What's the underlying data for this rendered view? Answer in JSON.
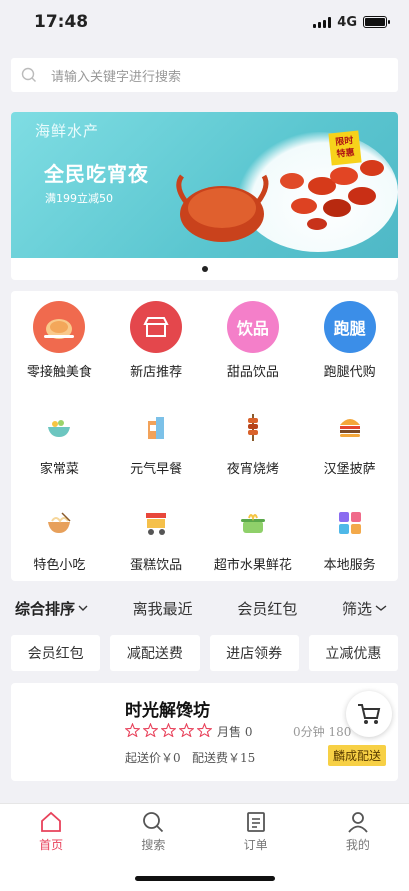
{
  "status": {
    "time": "17:48",
    "network": "4G"
  },
  "search": {
    "placeholder": "请输入关键字进行搜索"
  },
  "banner": {
    "category": "海鲜水产",
    "title": "全民吃宵夜",
    "subtitle": "满199立减50",
    "seal_line1": "限时",
    "seal_line2": "特惠"
  },
  "categories": [
    {
      "label": "零接触美食",
      "icon": "roast-chicken-icon"
    },
    {
      "label": "新店推荐",
      "icon": "shop-icon"
    },
    {
      "label": "甜品饮品",
      "icon": "drink-icon",
      "icon_text": "饮品"
    },
    {
      "label": "跑腿代购",
      "icon": "errand-icon",
      "icon_text": "跑腿"
    },
    {
      "label": "家常菜",
      "icon": "bowl-icon"
    },
    {
      "label": "元气早餐",
      "icon": "breakfast-icon"
    },
    {
      "label": "夜宵烧烤",
      "icon": "skewer-icon"
    },
    {
      "label": "汉堡披萨",
      "icon": "burger-icon"
    },
    {
      "label": "特色小吃",
      "icon": "noodle-bowl-icon"
    },
    {
      "label": "蛋糕饮品",
      "icon": "food-cart-icon"
    },
    {
      "label": "超市水果鲜花",
      "icon": "pot-icon"
    },
    {
      "label": "本地服务",
      "icon": "grid-apps-icon"
    }
  ],
  "sort": {
    "comprehensive": "综合排序",
    "nearest": "离我最近",
    "member": "会员红包",
    "filter": "筛选"
  },
  "filters": [
    "会员红包",
    "减配送费",
    "进店领券",
    "立减优惠"
  ],
  "shop": {
    "name": "时光解馋坊",
    "monthly_sales": "月售 0",
    "time_distance": "0分钟  180",
    "min_price": "起送价￥0",
    "delivery_fee": "配送费￥15",
    "delivery_badge": "麟成配送",
    "rating_stars": 0
  },
  "tabbar": [
    {
      "label": "首页",
      "icon": "home-icon",
      "active": true
    },
    {
      "label": "搜索",
      "icon": "search-icon",
      "active": false
    },
    {
      "label": "订单",
      "icon": "order-icon",
      "active": false
    },
    {
      "label": "我的",
      "icon": "profile-icon",
      "active": false
    }
  ],
  "colors": {
    "accent": "#e8425b",
    "banner": "#5bc6d0",
    "badge": "#f7d045"
  }
}
